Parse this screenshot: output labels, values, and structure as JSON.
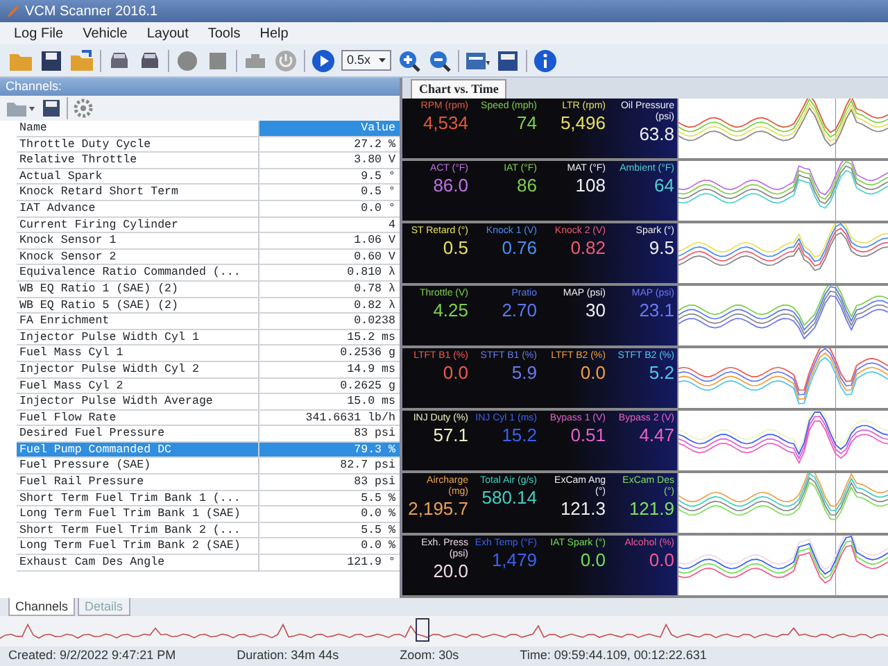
{
  "window": {
    "title": "VCM Scanner 2016.1"
  },
  "menu": [
    "Log File",
    "Vehicle",
    "Layout",
    "Tools",
    "Help"
  ],
  "toolbar": {
    "speed": "0.5x"
  },
  "channels_panel": {
    "title": "Channels:",
    "columns": [
      "Name",
      "Value"
    ],
    "rows": [
      {
        "name": "Throttle Duty Cycle",
        "value": "27.2 %",
        "selected": false
      },
      {
        "name": "Relative Throttle",
        "value": "3.80 V",
        "selected": false
      },
      {
        "name": "Actual Spark",
        "value": "9.5 °",
        "selected": false
      },
      {
        "name": "Knock Retard Short Term",
        "value": "0.5 °",
        "selected": false
      },
      {
        "name": "IAT Advance",
        "value": "0.0 °",
        "selected": false
      },
      {
        "name": "Current Firing Cylinder",
        "value": "4",
        "selected": false
      },
      {
        "name": "Knock Sensor 1",
        "value": "1.06 V",
        "selected": false
      },
      {
        "name": "Knock Sensor 2",
        "value": "0.60 V",
        "selected": false
      },
      {
        "name": "Equivalence Ratio Commanded (...",
        "value": "0.810 λ",
        "selected": false
      },
      {
        "name": "WB EQ Ratio 1 (SAE) (2)",
        "value": "0.78 λ",
        "selected": false
      },
      {
        "name": "WB EQ Ratio 5 (SAE) (2)",
        "value": "0.82 λ",
        "selected": false
      },
      {
        "name": "FA Enrichment",
        "value": "0.0238",
        "selected": false
      },
      {
        "name": "Injector Pulse Width Cyl 1",
        "value": "15.2 ms",
        "selected": false
      },
      {
        "name": "Fuel Mass Cyl 1",
        "value": "0.2536 g",
        "selected": false
      },
      {
        "name": "Injector Pulse Width Cyl 2",
        "value": "14.9 ms",
        "selected": false
      },
      {
        "name": "Fuel Mass Cyl 2",
        "value": "0.2625 g",
        "selected": false
      },
      {
        "name": "Injector Pulse Width Average",
        "value": "15.0 ms",
        "selected": false
      },
      {
        "name": "Fuel Flow Rate",
        "value": "341.6631 lb/h",
        "selected": false
      },
      {
        "name": "Desired Fuel Pressure",
        "value": "83 psi",
        "selected": false
      },
      {
        "name": "Fuel Pump Commanded DC",
        "value": "79.3 %",
        "selected": true
      },
      {
        "name": "Fuel Pressure (SAE)",
        "value": "82.7 psi",
        "selected": false
      },
      {
        "name": "Fuel Rail Pressure",
        "value": "83 psi",
        "selected": false
      },
      {
        "name": "Short Term Fuel Trim Bank 1 (...",
        "value": "5.5 %",
        "selected": false
      },
      {
        "name": "Long Term Fuel Trim Bank 1 (SAE)",
        "value": "0.0 %",
        "selected": false
      },
      {
        "name": "Short Term Fuel Trim Bank 2 (...",
        "value": "5.5 %",
        "selected": false
      },
      {
        "name": "Long Term Fuel Trim Bank 2 (SAE)",
        "value": "0.0 %",
        "selected": false
      },
      {
        "name": "Exhaust Cam Des Angle",
        "value": "121.9 °",
        "selected": false
      }
    ],
    "tabs": [
      {
        "label": "Channels",
        "selected": true
      },
      {
        "label": "Details",
        "selected": false
      }
    ]
  },
  "chart_tab": {
    "label": "Chart vs. Time"
  },
  "gauge_rows": [
    [
      {
        "label": "RPM (rpm)",
        "value": "4,534",
        "color": "#e05a3a"
      },
      {
        "label": "Speed (mph)",
        "value": "74",
        "color": "#7ed04a"
      },
      {
        "label": "LTR (rpm)",
        "value": "5,496",
        "color": "#e8e05a"
      },
      {
        "label": "Oil Pressure (psi)",
        "value": "63.8",
        "color": "#f0f0f0"
      }
    ],
    [
      {
        "label": "ACT (°F)",
        "value": "86.0",
        "color": "#c070e8"
      },
      {
        "label": "IAT (°F)",
        "value": "86",
        "color": "#7ed04a"
      },
      {
        "label": "MAT (°F)",
        "value": "108",
        "color": "#f0f0f0"
      },
      {
        "label": "Ambient (°F)",
        "value": "64",
        "color": "#50d0d0"
      }
    ],
    [
      {
        "label": "ST Retard (°)",
        "value": "0.5",
        "color": "#e8e05a"
      },
      {
        "label": "Knock 1 (V)",
        "value": "0.76",
        "color": "#4a8ef0"
      },
      {
        "label": "Knock 2 (V)",
        "value": "0.82",
        "color": "#f05a70"
      },
      {
        "label": "Spark (°)",
        "value": "9.5",
        "color": "#f0f0f0"
      }
    ],
    [
      {
        "label": "Throttle (V)",
        "value": "4.25",
        "color": "#7ed04a"
      },
      {
        "label": "Pratio",
        "value": "2.70",
        "color": "#5a7af0"
      },
      {
        "label": "MAP (psi)",
        "value": "30",
        "color": "#f0f0f0"
      },
      {
        "label": "MAP (psi)",
        "value": "23.1",
        "color": "#6a7af0"
      }
    ],
    [
      {
        "label": "LTFT B1 (%)",
        "value": "0.0",
        "color": "#f05a50"
      },
      {
        "label": "STFT B1 (%)",
        "value": "5.9",
        "color": "#6a7af0"
      },
      {
        "label": "LTFT B2 (%)",
        "value": "0.0",
        "color": "#f0a040"
      },
      {
        "label": "STFT B2 (%)",
        "value": "5.2",
        "color": "#50c8f0"
      }
    ],
    [
      {
        "label": "INJ Duty (%)",
        "value": "57.1",
        "color": "#f0f0c0"
      },
      {
        "label": "INJ Cyl 1 (ms)",
        "value": "15.2",
        "color": "#3a60f0"
      },
      {
        "label": "Bypass 1 (V)",
        "value": "0.51",
        "color": "#e060d0"
      },
      {
        "label": "Bypass 2 (V)",
        "value": "4.47",
        "color": "#f060c0"
      }
    ],
    [
      {
        "label": "Aircharge (mg)",
        "value": "2,195.7",
        "color": "#f0a050"
      },
      {
        "label": "Total Air (g/s)",
        "value": "580.14",
        "color": "#40d0c0"
      },
      {
        "label": "ExCam Ang (°)",
        "value": "121.3",
        "color": "#f0f0f0"
      },
      {
        "label": "ExCam Des (°)",
        "value": "121.9",
        "color": "#80e060"
      }
    ],
    [
      {
        "label": "Exh. Press (psi)",
        "value": "20.0",
        "color": "#f0d8e8"
      },
      {
        "label": "Exh Temp (°F)",
        "value": "1,479",
        "color": "#3a60f0"
      },
      {
        "label": "IAT Spark (°)",
        "value": "0.0",
        "color": "#70e050"
      },
      {
        "label": "Alcohol (%)",
        "value": "0.0",
        "color": "#f05a90"
      }
    ]
  ],
  "status_bar": {
    "created": "Created: 9/2/2022 9:47:21 PM",
    "duration": "Duration: 34m 44s",
    "zoom": "Zoom: 30s",
    "time": "Time: 09:59:44.109, 00:12:22.631"
  }
}
